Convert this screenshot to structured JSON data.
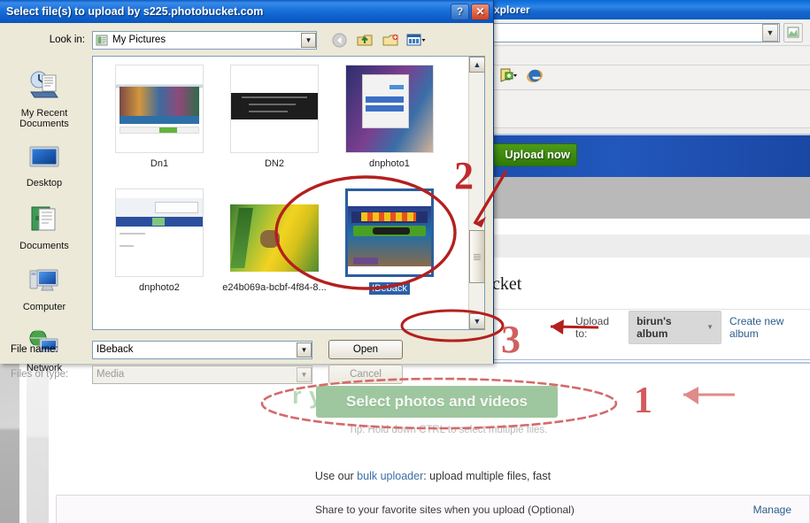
{
  "background": {
    "ie_title": "xplorer",
    "address_value": "",
    "icons": {
      "go": "go-page-icon",
      "tabs": "new-tab-icon",
      "ie_logo": "internet-explorer-icon"
    }
  },
  "photobucket": {
    "upload_now_label": "Upload now",
    "watermark": "photobucket",
    "heading_fragment": "cket",
    "upload_to_label": "Upload to:",
    "album_name": "birun's album",
    "create_album_label": "Create new album",
    "select_button_label": "Select photos and videos",
    "memories_ghost": "r your memori",
    "tip_text": "Tip: Hold down CTRL to select multiple files.",
    "bulk_prefix": "Use our ",
    "bulk_link": "bulk uploader",
    "bulk_suffix": ": upload multiple files, fast",
    "share_text": "Share to your favorite sites when you upload (Optional)",
    "manage_label": "Manage"
  },
  "dialog": {
    "title": "Select file(s) to upload by s225.photobucket.com",
    "help_label": "?",
    "close_label": "✕",
    "look_in_label": "Look in:",
    "look_in_value": "My Pictures",
    "toolbar_icons": [
      "back-icon",
      "up-one-level-icon",
      "new-folder-icon",
      "views-icon"
    ],
    "file_name_label": "File name:",
    "file_name_value": "IBeback",
    "files_of_type_label": "Files of type:",
    "files_of_type_value": "Media",
    "open_label": "Open",
    "cancel_label": "Cancel",
    "places": [
      {
        "label": "My Recent\nDocuments",
        "icon": "recent-documents-icon"
      },
      {
        "label": "Desktop",
        "icon": "desktop-icon"
      },
      {
        "label": "Documents",
        "icon": "documents-icon"
      },
      {
        "label": "Computer",
        "icon": "computer-icon"
      },
      {
        "label": "Network",
        "icon": "network-icon"
      }
    ],
    "files": [
      {
        "label": "Dn1",
        "selected": false
      },
      {
        "label": "DN2",
        "selected": false
      },
      {
        "label": "dnphoto1",
        "selected": false
      },
      {
        "label": "dnphoto2",
        "selected": false
      },
      {
        "label": "e24b069a-bcbf-4f84-8...",
        "selected": false
      },
      {
        "label": "IBeback",
        "selected": true
      }
    ]
  },
  "annotations": {
    "step1": "1",
    "step2": "2",
    "step3": "3",
    "color": "#c63333"
  }
}
